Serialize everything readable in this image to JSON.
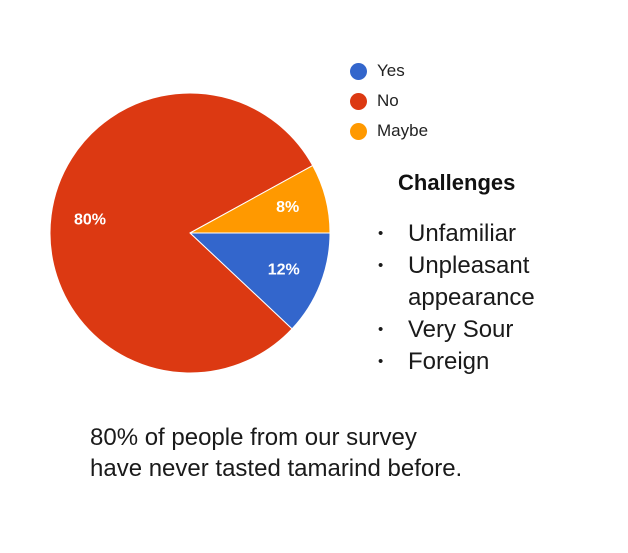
{
  "chart_data": {
    "type": "pie",
    "categories": [
      "Yes",
      "No",
      "Maybe"
    ],
    "values": [
      12,
      80,
      8
    ],
    "value_labels": [
      "12%",
      "80%",
      "8%"
    ],
    "colors": [
      "#3366cc",
      "#dc3912",
      "#ff9900"
    ],
    "legend_position": "top-right",
    "title": "",
    "xlabel": "",
    "ylabel": ""
  },
  "legend": {
    "items": [
      {
        "label": "Yes",
        "color": "#3366cc"
      },
      {
        "label": "No",
        "color": "#dc3912"
      },
      {
        "label": "Maybe",
        "color": "#ff9900"
      }
    ]
  },
  "challenges": {
    "title": "Challenges",
    "bullet": "•",
    "items": [
      "Unfamiliar",
      "Unpleasant appearance",
      "Very Sour",
      "Foreign"
    ]
  },
  "caption": {
    "line1": "80% of people from our survey",
    "line2": "have never tasted tamarind before."
  }
}
